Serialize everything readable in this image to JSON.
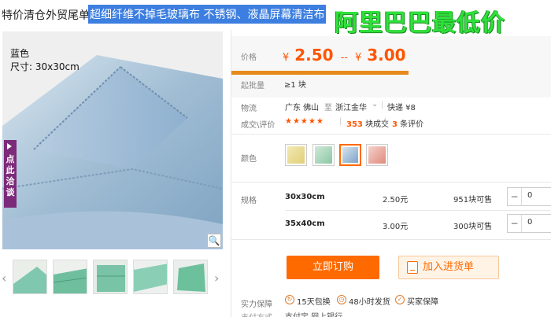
{
  "header": {
    "title_plain": "特价清仓外贸尾单",
    "title_highlight": "超细纤维不掉毛玻璃布 不锈钢、液晶屏幕清洁布",
    "promo": "阿里巴巴最低价"
  },
  "gallery": {
    "label_color": "蓝色",
    "label_size": "尺寸: 30x30cm",
    "side_tab": "点此洽谈",
    "zoom_icon": "magnifier-icon"
  },
  "price": {
    "label": "价格",
    "currency": "¥",
    "low": "2.50",
    "sep": "--",
    "high": "3.00",
    "moq_label": "起批量",
    "moq_value": "≥1 块"
  },
  "logistics": {
    "label": "物流",
    "from": "广东 佛山",
    "to_word": "至",
    "to": "浙江金华",
    "express": "快递 ¥8"
  },
  "reviews": {
    "label": "成交\\评价",
    "stars": "★★★★★",
    "deals_count": "353",
    "deals_label": "块成交",
    "review_count": "3",
    "review_label": "条评价"
  },
  "color": {
    "label": "颜色"
  },
  "specs": {
    "label": "规格",
    "rows": [
      {
        "name": "30x30cm",
        "price": "2.50元",
        "stock": "951块可售",
        "qty": "0"
      },
      {
        "name": "35x40cm",
        "price": "3.00元",
        "stock": "300块可售",
        "qty": "0"
      }
    ]
  },
  "actions": {
    "order": "立即订购",
    "cart": "加入进货单"
  },
  "services": {
    "label": "实力保障",
    "items": [
      "15天包换",
      "48小时发货",
      "买家保障"
    ],
    "pay_label": "支付方式",
    "pay_value": "支付宝  网上银行"
  },
  "colors": {
    "accent": "#ff6a00",
    "price": "#ff5500",
    "highlight": "#3d7fe0",
    "promo_green": "#2fe03a"
  }
}
